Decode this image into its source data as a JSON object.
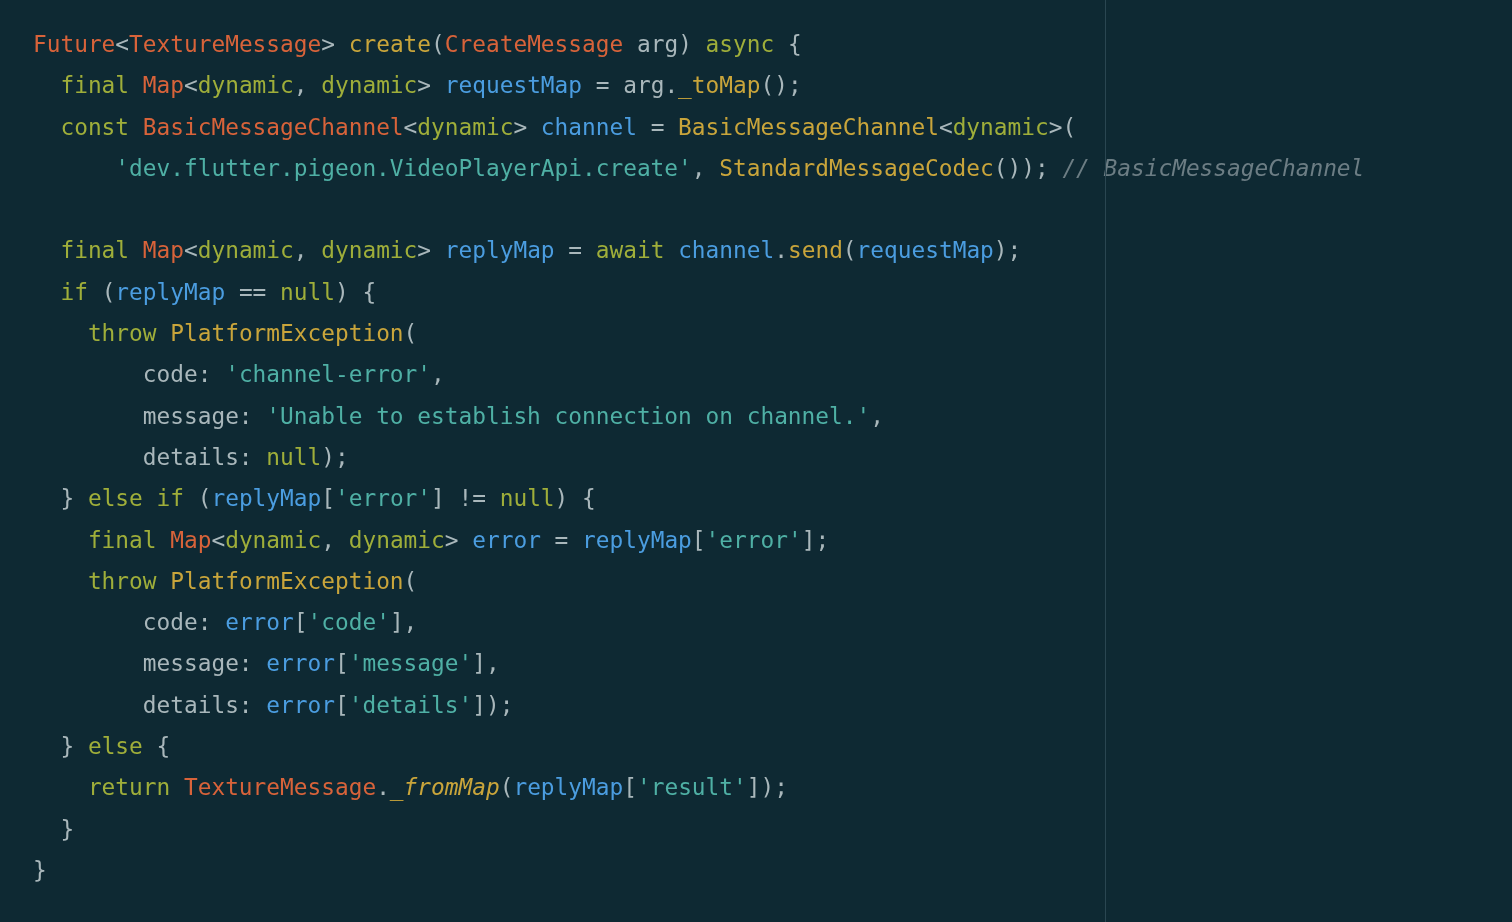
{
  "editor": {
    "lines": [
      {
        "tokens": [
          {
            "kind": "type",
            "text": "Future"
          },
          {
            "kind": "plain",
            "text": "<"
          },
          {
            "kind": "type",
            "text": "TextureMessage"
          },
          {
            "kind": "plain",
            "text": "> "
          },
          {
            "kind": "function",
            "text": "create"
          },
          {
            "kind": "plain",
            "text": "("
          },
          {
            "kind": "type",
            "text": "CreateMessage"
          },
          {
            "kind": "plain",
            "text": " arg) "
          },
          {
            "kind": "keyword",
            "text": "async"
          },
          {
            "kind": "plain",
            "text": " {"
          }
        ]
      },
      {
        "tokens": [
          {
            "kind": "keyword",
            "text": "  final"
          },
          {
            "kind": "type",
            "text": " Map"
          },
          {
            "kind": "plain",
            "text": "<"
          },
          {
            "kind": "keyword",
            "text": "dynamic"
          },
          {
            "kind": "plain",
            "text": ", "
          },
          {
            "kind": "keyword",
            "text": "dynamic"
          },
          {
            "kind": "plain",
            "text": "> "
          },
          {
            "kind": "variable",
            "text": "requestMap"
          },
          {
            "kind": "plain",
            "text": " = arg."
          },
          {
            "kind": "function",
            "text": "_toMap"
          },
          {
            "kind": "plain",
            "text": "();"
          }
        ]
      },
      {
        "tokens": [
          {
            "kind": "keyword",
            "text": "  const"
          },
          {
            "kind": "type",
            "text": " BasicMessageChannel"
          },
          {
            "kind": "plain",
            "text": "<"
          },
          {
            "kind": "keyword",
            "text": "dynamic"
          },
          {
            "kind": "plain",
            "text": "> "
          },
          {
            "kind": "variable",
            "text": "channel"
          },
          {
            "kind": "plain",
            "text": " = "
          },
          {
            "kind": "function",
            "text": "BasicMessageChannel"
          },
          {
            "kind": "plain",
            "text": "<"
          },
          {
            "kind": "keyword",
            "text": "dynamic"
          },
          {
            "kind": "plain",
            "text": ">("
          }
        ]
      },
      {
        "tokens": [
          {
            "kind": "string",
            "text": "      'dev.flutter.pigeon.VideoPlayerApi.create'"
          },
          {
            "kind": "plain",
            "text": ", "
          },
          {
            "kind": "function",
            "text": "StandardMessageCodec"
          },
          {
            "kind": "plain",
            "text": "()); "
          },
          {
            "kind": "comment",
            "text": "// BasicMessageChannel"
          }
        ]
      },
      {
        "space_before": true,
        "tokens": [
          {
            "kind": "keyword",
            "text": "  final"
          },
          {
            "kind": "type",
            "text": " Map"
          },
          {
            "kind": "plain",
            "text": "<"
          },
          {
            "kind": "keyword",
            "text": "dynamic"
          },
          {
            "kind": "plain",
            "text": ", "
          },
          {
            "kind": "keyword",
            "text": "dynamic"
          },
          {
            "kind": "plain",
            "text": "> "
          },
          {
            "kind": "variable",
            "text": "replyMap"
          },
          {
            "kind": "plain",
            "text": " = "
          },
          {
            "kind": "keyword",
            "text": "await"
          },
          {
            "kind": "variable",
            "text": " channel"
          },
          {
            "kind": "plain",
            "text": "."
          },
          {
            "kind": "function",
            "text": "send"
          },
          {
            "kind": "plain",
            "text": "("
          },
          {
            "kind": "variable",
            "text": "requestMap"
          },
          {
            "kind": "plain",
            "text": ");"
          }
        ]
      },
      {
        "tokens": [
          {
            "kind": "keyword",
            "text": "  if"
          },
          {
            "kind": "plain",
            "text": " ("
          },
          {
            "kind": "variable",
            "text": "replyMap"
          },
          {
            "kind": "plain",
            "text": " == "
          },
          {
            "kind": "keyword",
            "text": "null"
          },
          {
            "kind": "plain",
            "text": ") {"
          }
        ]
      },
      {
        "tokens": [
          {
            "kind": "keyword",
            "text": "    throw"
          },
          {
            "kind": "function",
            "text": " PlatformException"
          },
          {
            "kind": "plain",
            "text": "("
          }
        ]
      },
      {
        "tokens": [
          {
            "kind": "plain",
            "text": "        code: "
          },
          {
            "kind": "string",
            "text": "'channel-error'"
          },
          {
            "kind": "plain",
            "text": ","
          }
        ]
      },
      {
        "tokens": [
          {
            "kind": "plain",
            "text": "        message: "
          },
          {
            "kind": "string",
            "text": "'Unable to establish connection on channel.'"
          },
          {
            "kind": "plain",
            "text": ","
          }
        ]
      },
      {
        "tokens": [
          {
            "kind": "plain",
            "text": "        details: "
          },
          {
            "kind": "keyword",
            "text": "null"
          },
          {
            "kind": "plain",
            "text": ");"
          }
        ]
      },
      {
        "tokens": [
          {
            "kind": "plain",
            "text": "  } "
          },
          {
            "kind": "keyword",
            "text": "else if"
          },
          {
            "kind": "plain",
            "text": " ("
          },
          {
            "kind": "variable",
            "text": "replyMap"
          },
          {
            "kind": "plain",
            "text": "["
          },
          {
            "kind": "string",
            "text": "'error'"
          },
          {
            "kind": "plain",
            "text": "] != "
          },
          {
            "kind": "keyword",
            "text": "null"
          },
          {
            "kind": "plain",
            "text": ") {"
          }
        ]
      },
      {
        "tokens": [
          {
            "kind": "keyword",
            "text": "    final"
          },
          {
            "kind": "type",
            "text": " Map"
          },
          {
            "kind": "plain",
            "text": "<"
          },
          {
            "kind": "keyword",
            "text": "dynamic"
          },
          {
            "kind": "plain",
            "text": ", "
          },
          {
            "kind": "keyword",
            "text": "dynamic"
          },
          {
            "kind": "plain",
            "text": "> "
          },
          {
            "kind": "variable",
            "text": "error"
          },
          {
            "kind": "plain",
            "text": " = "
          },
          {
            "kind": "variable",
            "text": "replyMap"
          },
          {
            "kind": "plain",
            "text": "["
          },
          {
            "kind": "string",
            "text": "'error'"
          },
          {
            "kind": "plain",
            "text": "];"
          }
        ]
      },
      {
        "tokens": [
          {
            "kind": "keyword",
            "text": "    throw"
          },
          {
            "kind": "function",
            "text": " PlatformException"
          },
          {
            "kind": "plain",
            "text": "("
          }
        ]
      },
      {
        "tokens": [
          {
            "kind": "plain",
            "text": "        code: "
          },
          {
            "kind": "variable",
            "text": "error"
          },
          {
            "kind": "plain",
            "text": "["
          },
          {
            "kind": "string",
            "text": "'code'"
          },
          {
            "kind": "plain",
            "text": "],"
          }
        ]
      },
      {
        "tokens": [
          {
            "kind": "plain",
            "text": "        message: "
          },
          {
            "kind": "variable",
            "text": "error"
          },
          {
            "kind": "plain",
            "text": "["
          },
          {
            "kind": "string",
            "text": "'message'"
          },
          {
            "kind": "plain",
            "text": "],"
          }
        ]
      },
      {
        "tokens": [
          {
            "kind": "plain",
            "text": "        details: "
          },
          {
            "kind": "variable",
            "text": "error"
          },
          {
            "kind": "plain",
            "text": "["
          },
          {
            "kind": "string",
            "text": "'details'"
          },
          {
            "kind": "plain",
            "text": "]);"
          }
        ]
      },
      {
        "tokens": [
          {
            "kind": "plain",
            "text": "  } "
          },
          {
            "kind": "keyword",
            "text": "else"
          },
          {
            "kind": "plain",
            "text": " {"
          }
        ]
      },
      {
        "tokens": [
          {
            "kind": "keyword",
            "text": "    return"
          },
          {
            "kind": "type",
            "text": " TextureMessage"
          },
          {
            "kind": "plain",
            "text": "."
          },
          {
            "kind": "static",
            "text": "_fromMap"
          },
          {
            "kind": "plain",
            "text": "("
          },
          {
            "kind": "variable",
            "text": "replyMap"
          },
          {
            "kind": "plain",
            "text": "["
          },
          {
            "kind": "string",
            "text": "'result'"
          },
          {
            "kind": "plain",
            "text": "]);"
          }
        ]
      },
      {
        "tokens": [
          {
            "kind": "plain",
            "text": "  }"
          }
        ]
      },
      {
        "tokens": [
          {
            "kind": "plain",
            "text": "}"
          }
        ]
      }
    ]
  }
}
